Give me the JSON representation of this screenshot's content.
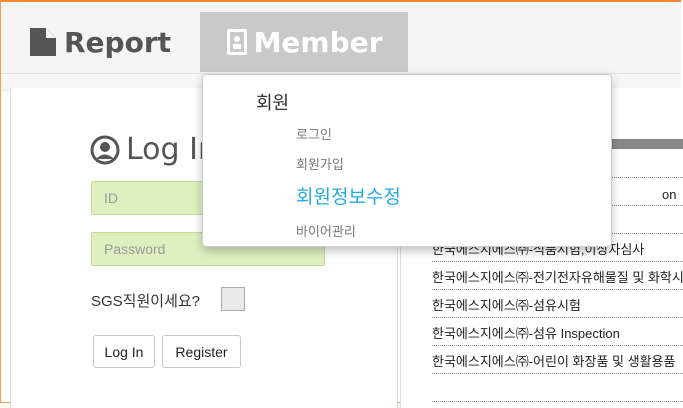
{
  "nav": {
    "report_label": "Report",
    "member_label": "Member"
  },
  "dropdown": {
    "header": "회원",
    "items": [
      {
        "label": "로그인"
      },
      {
        "label": "회원가입"
      },
      {
        "label": "회원정보수정",
        "active": true
      },
      {
        "label": "바이어관리"
      }
    ]
  },
  "login": {
    "title": "Log In",
    "id_placeholder": "ID",
    "password_placeholder": "Password",
    "sgs_question": "SGS직원이세요?",
    "login_button": "Log In",
    "register_button": "Register"
  },
  "right_list": {
    "rows": [
      "",
      "on",
      "",
      "한국에스지에스㈜-식품시험,이상자심사",
      "한국에스지에스㈜-전기전자유해물질 및 화학시험",
      "한국에스지에스㈜-섬유시험",
      "한국에스지에스㈜-섬유 Inspection",
      "한국에스지에스㈜-어린이 화장품 및 생활용품"
    ]
  },
  "colors": {
    "accent_blue": "#25a9e0",
    "input_green": "#dff0c0",
    "frame_orange": "#f08a30"
  }
}
